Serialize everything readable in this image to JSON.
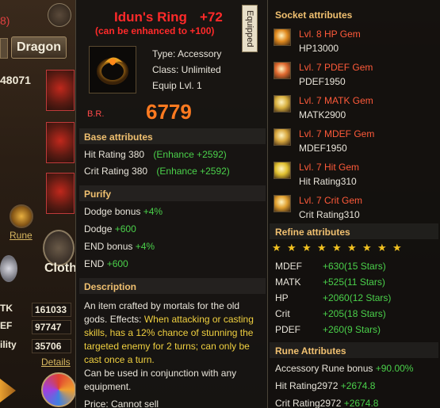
{
  "background": {
    "red_number": "8)",
    "tab_label": "Dragon",
    "power": "48071",
    "rune_link": "Rune",
    "cloth_label": "Cloth",
    "stats": [
      {
        "key": "TK",
        "value": "161033"
      },
      {
        "key": "EF",
        "value": "97747"
      },
      {
        "key": "ility",
        "value": "35706"
      }
    ],
    "details_link": "Details"
  },
  "item": {
    "name": "Idun's Ring",
    "enhance_level": "+72",
    "enhance_note": "(can be enhanced to +100)",
    "equipped_label": "Equipped",
    "type": "Type: Accessory",
    "class": "Class: Unlimited",
    "equip_level": "Equip Lvl. 1",
    "br_label": "B.R.",
    "br_value": "6779",
    "base_title": "Base attributes",
    "base": [
      {
        "label": "Hit Rating 380",
        "bonus": "(Enhance +2592)"
      },
      {
        "label": "Crit Rating 380",
        "bonus": "(Enhance +2592)"
      }
    ],
    "purify_title": "Purify",
    "purify": [
      {
        "label": "Dodge bonus",
        "bonus": "+4%"
      },
      {
        "label": "Dodge",
        "bonus": "+600"
      },
      {
        "label": "END bonus",
        "bonus": "+4%"
      },
      {
        "label": "END",
        "bonus": "+600"
      }
    ],
    "desc_title": "Description",
    "desc_1": "An item crafted by mortals for the old gods. Effects: ",
    "desc_2": "When attacking or casting skills, has a 12% chance of stunning the targeted enemy for 2 turns; can only be cast once a turn.",
    "desc_3": " Can be used in conjunction with any equipment.",
    "price": "Price: Cannot sell"
  },
  "sockets": {
    "title": "Socket attributes",
    "gems": [
      {
        "name": "Lvl. 8 HP Gem",
        "stat": "HP13000",
        "color": "#e08a20"
      },
      {
        "name": "Lvl. 7 PDEF Gem",
        "stat": "PDEF1950",
        "color": "#e06a30"
      },
      {
        "name": "Lvl. 7 MATK Gem",
        "stat": "MATK2900",
        "color": "#d8b040"
      },
      {
        "name": "Lvl. 7 MDEF Gem",
        "stat": "MDEF1950",
        "color": "#d8a840"
      },
      {
        "name": "Lvl. 7 Hit Gem",
        "stat": "Hit Rating310",
        "color": "#e0c030"
      },
      {
        "name": "Lvl. 7 Crit Gem",
        "stat": "Crit Rating310",
        "color": "#e0a030"
      }
    ],
    "refine_title": "Refine attributes",
    "stars": 9,
    "refine": [
      {
        "key": "MDEF",
        "value": "+630(15 Stars)"
      },
      {
        "key": "MATK",
        "value": "+525(11 Stars)"
      },
      {
        "key": "HP",
        "value": "+2060(12 Stars)"
      },
      {
        "key": "Crit",
        "value": "+205(18 Stars)"
      },
      {
        "key": "PDEF",
        "value": "+260(9 Stars)"
      }
    ],
    "rune_title": "Rune Attributes",
    "rune": [
      {
        "label": "Accessory Rune bonus",
        "value": "+90.00%"
      },
      {
        "label": "Hit Rating2972",
        "value": "+2674.8"
      },
      {
        "label": "Crit Rating2972",
        "value": "+2674.8"
      }
    ]
  }
}
